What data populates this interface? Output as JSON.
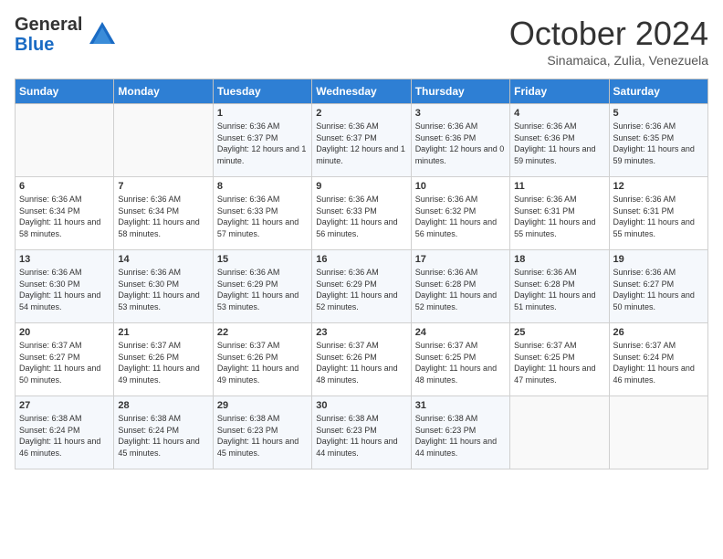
{
  "header": {
    "logo_general": "General",
    "logo_blue": "Blue",
    "month_title": "October 2024",
    "subtitle": "Sinamaica, Zulia, Venezuela"
  },
  "days_of_week": [
    "Sunday",
    "Monday",
    "Tuesday",
    "Wednesday",
    "Thursday",
    "Friday",
    "Saturday"
  ],
  "weeks": [
    [
      {
        "day": "",
        "sunrise": "",
        "sunset": "",
        "daylight": ""
      },
      {
        "day": "",
        "sunrise": "",
        "sunset": "",
        "daylight": ""
      },
      {
        "day": "1",
        "sunrise": "Sunrise: 6:36 AM",
        "sunset": "Sunset: 6:37 PM",
        "daylight": "Daylight: 12 hours and 1 minute."
      },
      {
        "day": "2",
        "sunrise": "Sunrise: 6:36 AM",
        "sunset": "Sunset: 6:37 PM",
        "daylight": "Daylight: 12 hours and 1 minute."
      },
      {
        "day": "3",
        "sunrise": "Sunrise: 6:36 AM",
        "sunset": "Sunset: 6:36 PM",
        "daylight": "Daylight: 12 hours and 0 minutes."
      },
      {
        "day": "4",
        "sunrise": "Sunrise: 6:36 AM",
        "sunset": "Sunset: 6:36 PM",
        "daylight": "Daylight: 11 hours and 59 minutes."
      },
      {
        "day": "5",
        "sunrise": "Sunrise: 6:36 AM",
        "sunset": "Sunset: 6:35 PM",
        "daylight": "Daylight: 11 hours and 59 minutes."
      }
    ],
    [
      {
        "day": "6",
        "sunrise": "Sunrise: 6:36 AM",
        "sunset": "Sunset: 6:34 PM",
        "daylight": "Daylight: 11 hours and 58 minutes."
      },
      {
        "day": "7",
        "sunrise": "Sunrise: 6:36 AM",
        "sunset": "Sunset: 6:34 PM",
        "daylight": "Daylight: 11 hours and 58 minutes."
      },
      {
        "day": "8",
        "sunrise": "Sunrise: 6:36 AM",
        "sunset": "Sunset: 6:33 PM",
        "daylight": "Daylight: 11 hours and 57 minutes."
      },
      {
        "day": "9",
        "sunrise": "Sunrise: 6:36 AM",
        "sunset": "Sunset: 6:33 PM",
        "daylight": "Daylight: 11 hours and 56 minutes."
      },
      {
        "day": "10",
        "sunrise": "Sunrise: 6:36 AM",
        "sunset": "Sunset: 6:32 PM",
        "daylight": "Daylight: 11 hours and 56 minutes."
      },
      {
        "day": "11",
        "sunrise": "Sunrise: 6:36 AM",
        "sunset": "Sunset: 6:31 PM",
        "daylight": "Daylight: 11 hours and 55 minutes."
      },
      {
        "day": "12",
        "sunrise": "Sunrise: 6:36 AM",
        "sunset": "Sunset: 6:31 PM",
        "daylight": "Daylight: 11 hours and 55 minutes."
      }
    ],
    [
      {
        "day": "13",
        "sunrise": "Sunrise: 6:36 AM",
        "sunset": "Sunset: 6:30 PM",
        "daylight": "Daylight: 11 hours and 54 minutes."
      },
      {
        "day": "14",
        "sunrise": "Sunrise: 6:36 AM",
        "sunset": "Sunset: 6:30 PM",
        "daylight": "Daylight: 11 hours and 53 minutes."
      },
      {
        "day": "15",
        "sunrise": "Sunrise: 6:36 AM",
        "sunset": "Sunset: 6:29 PM",
        "daylight": "Daylight: 11 hours and 53 minutes."
      },
      {
        "day": "16",
        "sunrise": "Sunrise: 6:36 AM",
        "sunset": "Sunset: 6:29 PM",
        "daylight": "Daylight: 11 hours and 52 minutes."
      },
      {
        "day": "17",
        "sunrise": "Sunrise: 6:36 AM",
        "sunset": "Sunset: 6:28 PM",
        "daylight": "Daylight: 11 hours and 52 minutes."
      },
      {
        "day": "18",
        "sunrise": "Sunrise: 6:36 AM",
        "sunset": "Sunset: 6:28 PM",
        "daylight": "Daylight: 11 hours and 51 minutes."
      },
      {
        "day": "19",
        "sunrise": "Sunrise: 6:36 AM",
        "sunset": "Sunset: 6:27 PM",
        "daylight": "Daylight: 11 hours and 50 minutes."
      }
    ],
    [
      {
        "day": "20",
        "sunrise": "Sunrise: 6:37 AM",
        "sunset": "Sunset: 6:27 PM",
        "daylight": "Daylight: 11 hours and 50 minutes."
      },
      {
        "day": "21",
        "sunrise": "Sunrise: 6:37 AM",
        "sunset": "Sunset: 6:26 PM",
        "daylight": "Daylight: 11 hours and 49 minutes."
      },
      {
        "day": "22",
        "sunrise": "Sunrise: 6:37 AM",
        "sunset": "Sunset: 6:26 PM",
        "daylight": "Daylight: 11 hours and 49 minutes."
      },
      {
        "day": "23",
        "sunrise": "Sunrise: 6:37 AM",
        "sunset": "Sunset: 6:26 PM",
        "daylight": "Daylight: 11 hours and 48 minutes."
      },
      {
        "day": "24",
        "sunrise": "Sunrise: 6:37 AM",
        "sunset": "Sunset: 6:25 PM",
        "daylight": "Daylight: 11 hours and 48 minutes."
      },
      {
        "day": "25",
        "sunrise": "Sunrise: 6:37 AM",
        "sunset": "Sunset: 6:25 PM",
        "daylight": "Daylight: 11 hours and 47 minutes."
      },
      {
        "day": "26",
        "sunrise": "Sunrise: 6:37 AM",
        "sunset": "Sunset: 6:24 PM",
        "daylight": "Daylight: 11 hours and 46 minutes."
      }
    ],
    [
      {
        "day": "27",
        "sunrise": "Sunrise: 6:38 AM",
        "sunset": "Sunset: 6:24 PM",
        "daylight": "Daylight: 11 hours and 46 minutes."
      },
      {
        "day": "28",
        "sunrise": "Sunrise: 6:38 AM",
        "sunset": "Sunset: 6:24 PM",
        "daylight": "Daylight: 11 hours and 45 minutes."
      },
      {
        "day": "29",
        "sunrise": "Sunrise: 6:38 AM",
        "sunset": "Sunset: 6:23 PM",
        "daylight": "Daylight: 11 hours and 45 minutes."
      },
      {
        "day": "30",
        "sunrise": "Sunrise: 6:38 AM",
        "sunset": "Sunset: 6:23 PM",
        "daylight": "Daylight: 11 hours and 44 minutes."
      },
      {
        "day": "31",
        "sunrise": "Sunrise: 6:38 AM",
        "sunset": "Sunset: 6:23 PM",
        "daylight": "Daylight: 11 hours and 44 minutes."
      },
      {
        "day": "",
        "sunrise": "",
        "sunset": "",
        "daylight": ""
      },
      {
        "day": "",
        "sunrise": "",
        "sunset": "",
        "daylight": ""
      }
    ]
  ]
}
